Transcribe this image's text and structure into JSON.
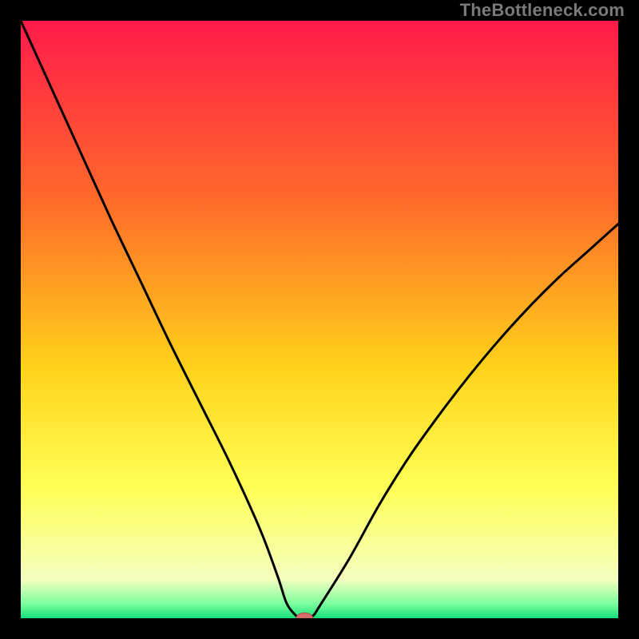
{
  "watermark": "TheBottleneck.com",
  "colors": {
    "frame_bg": "#000000",
    "watermark_text": "#7a7a7a",
    "curve_stroke": "#000000",
    "marker_fill": "#d46a6a",
    "marker_stroke": "#b24e4e",
    "gradient_top": "#ff1a4a",
    "gradient_mid1": "#ff6a2a",
    "gradient_mid2": "#ffd21a",
    "gradient_mid3": "#ffff55",
    "gradient_mid4": "#f4ffbf",
    "gradient_bottom": "#15e07a"
  },
  "chart_data": {
    "type": "line",
    "title": "",
    "xlabel": "",
    "ylabel": "",
    "xlim": [
      0,
      100
    ],
    "ylim": [
      0,
      100
    ],
    "series": [
      {
        "name": "bottleneck-curve",
        "x": [
          0,
          5,
          10,
          15,
          20,
          25,
          30,
          35,
          40,
          43,
          44.5,
          46,
          47,
          48,
          49,
          50,
          55,
          60,
          65,
          70,
          75,
          80,
          85,
          90,
          95,
          100
        ],
        "y": [
          100,
          89,
          78,
          67,
          56.5,
          46,
          36,
          26,
          15,
          7,
          2.5,
          0.5,
          0,
          0,
          0.5,
          2,
          10,
          19,
          27,
          34,
          40.5,
          46.5,
          52,
          57,
          61.5,
          66
        ]
      }
    ],
    "marker": {
      "x": 47.5,
      "y": 0,
      "rx": 1.4,
      "ry": 0.9
    },
    "flat_segment": {
      "x0": 46.2,
      "x1": 48.8,
      "y": 0
    },
    "background_bands": [
      {
        "offset": 0.0,
        "color": "#ff1a4a"
      },
      {
        "offset": 0.3,
        "color": "#ff6a2a"
      },
      {
        "offset": 0.58,
        "color": "#ffd21a"
      },
      {
        "offset": 0.78,
        "color": "#ffff55"
      },
      {
        "offset": 0.935,
        "color": "#f4ffbf"
      },
      {
        "offset": 0.975,
        "color": "#7fff9f"
      },
      {
        "offset": 1.0,
        "color": "#15e07a"
      }
    ]
  }
}
